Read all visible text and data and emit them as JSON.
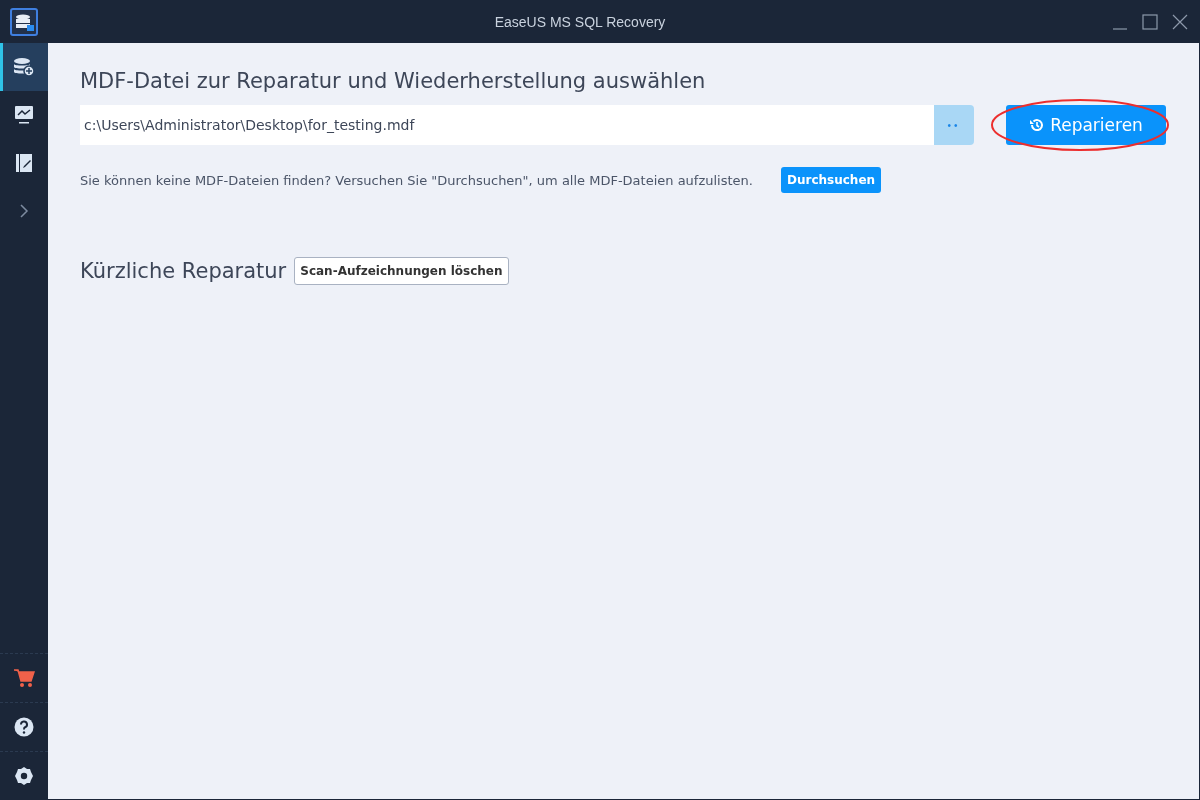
{
  "window": {
    "title": "EaseUS MS SQL Recovery"
  },
  "sidebar": {
    "items": [
      {
        "kind": "database",
        "selected": true
      },
      {
        "kind": "monitor",
        "selected": false
      },
      {
        "kind": "edit",
        "selected": false
      },
      {
        "kind": "expand",
        "selected": false
      }
    ],
    "bottom_items": [
      {
        "kind": "cart"
      },
      {
        "kind": "help"
      },
      {
        "kind": "settings"
      }
    ]
  },
  "heading": "MDF-Datei zur Reparatur und Wiederherstellung auswählen",
  "file_field": {
    "value": "c:\\Users\\Administrator\\Desktop\\for_testing.mdf",
    "browse_label": "••"
  },
  "repair_button": {
    "label": "Reparieren",
    "highlighted": true
  },
  "hint": "Sie können keine MDF-Dateien finden? Versuchen Sie \"Durchsuchen\", um alle MDF-Dateien aufzulisten.",
  "search_button": "Durchsuchen",
  "recent": {
    "title": "Kürzliche Reparatur",
    "clear_button": "Scan-Aufzeichnungen löschen"
  }
}
